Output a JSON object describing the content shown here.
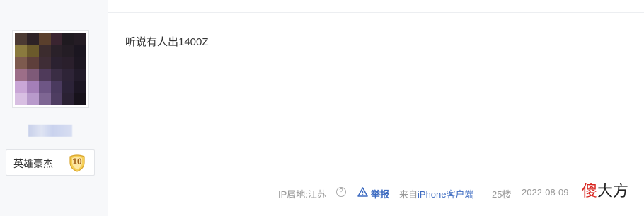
{
  "user": {
    "avatar_icon": "pixelated-avatar",
    "avatar_palette": [
      "#4b3a33",
      "#2d2226",
      "#5a3f2c",
      "#3a2430",
      "#1f1a20",
      "#241c24",
      "#8a7a3e",
      "#6b5a2b",
      "#3c2c2e",
      "#2a2129",
      "#241d25",
      "#1b1620",
      "#7d5a4e",
      "#5e3f3b",
      "#3f2d36",
      "#2b2130",
      "#2a1f2c",
      "#1d1722",
      "#9c6e88",
      "#7e5a78",
      "#4f3a5a",
      "#3a2d44",
      "#2e2437",
      "#221b2a",
      "#c9a6d6",
      "#a47fb8",
      "#6e5685",
      "#4a3a5e",
      "#2c2338",
      "#1c1623",
      "#d8bfe2",
      "#b89acb",
      "#7e6693",
      "#4e3d61",
      "#2a2133",
      "#17121b"
    ],
    "badge_title": "英雄豪杰",
    "badge_level": "10"
  },
  "post": {
    "content": "听说有人出1400Z"
  },
  "footer": {
    "ip_label": "IP属地:江苏",
    "help_icon": "?",
    "report_label": "举报",
    "client_prefix": "来自",
    "client_name": "iPhone客户端",
    "floor": "25楼",
    "datetime": "2022-08-09 "
  },
  "watermark": {
    "part1": "傻",
    "part2": "大方"
  },
  "colors": {
    "link": "#3d6bc1",
    "meta": "#999999",
    "badge_gold": "#f3c64a"
  }
}
